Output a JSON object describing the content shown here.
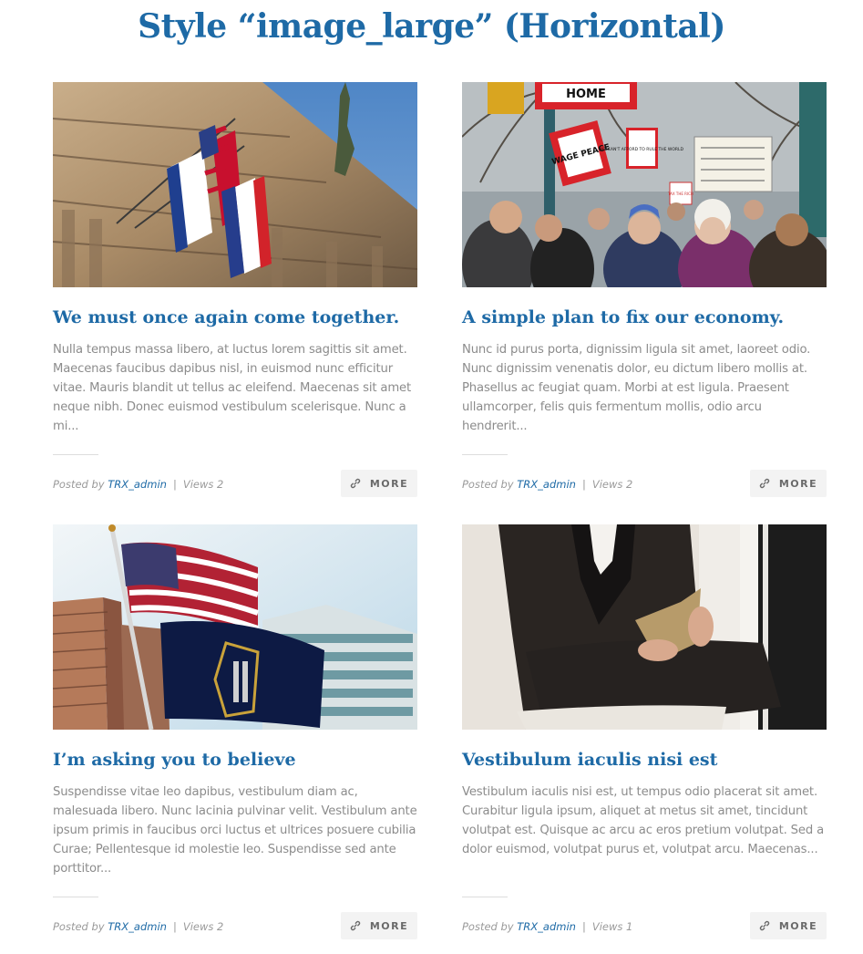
{
  "page": {
    "title": "Style “image_large” (Horizontal)"
  },
  "labels": {
    "posted_by": "Posted by",
    "views": "Views",
    "more": "MORE",
    "separator": "|"
  },
  "colors": {
    "accent": "#1e6aa6",
    "text": "#8c8c8c",
    "button_bg": "#f3f3f3"
  },
  "posts": [
    {
      "title": "We must once again come together.",
      "excerpt": "Nulla tempus massa libero, at luctus lorem sagittis sit amet. Maecenas faucibus dapibus nisl, in euismod nunc efficitur vitae. Mauris blandit ut tellus ac eleifend. Maecenas sit amet neque nibh. Donec euismod vestibulum scelerisque. Nunc a mi...",
      "author": "TRX_admin",
      "views": "2",
      "image": "building-with-flags-photo"
    },
    {
      "title": "A simple plan to fix our economy.",
      "excerpt": "Nunc id purus porta, dignissim ligula sit amet, laoreet odio. Nunc dignissim venenatis dolor, eu dictum libero mollis at. Phasellus ac feugiat quam. Morbi at est ligula. Praesent ullamcorper, felis quis fermentum mollis, odio arcu hendrerit...",
      "author": "TRX_admin",
      "views": "2",
      "image": "protest-crowd-photo",
      "signs": [
        "HOME",
        "WAGE PEACE",
        "WE CAN'T AFFORD TO RULE THE WORLD",
        "TAX THE RICH"
      ]
    },
    {
      "title": "I’m asking you to believe",
      "excerpt": "Suspendisse vitae leo dapibus, vestibulum diam ac, malesuada libero. Nunc lacinia pulvinar velit. Vestibulum ante ipsum primis in faucibus orci luctus et ultrices posuere cubilia Curae; Pellentesque id molestie leo. Suspendisse sed ante porttitor...",
      "author": "TRX_admin",
      "views": "2",
      "image": "flags-and-skyscrapers-photo"
    },
    {
      "title": "Vestibulum iaculis nisi est",
      "excerpt": "Vestibulum iaculis nisi est, ut tempus odio placerat sit amet. Curabitur ligula ipsum, aliquet at metus sit amet, tincidunt volutpat est. Quisque ac arcu ac eros pretium volutpat. Sed a dolor euismod, volutpat purus et, volutpat arcu. Maecenas...",
      "author": "TRX_admin",
      "views": "1",
      "image": "man-reading-book-photo"
    }
  ]
}
